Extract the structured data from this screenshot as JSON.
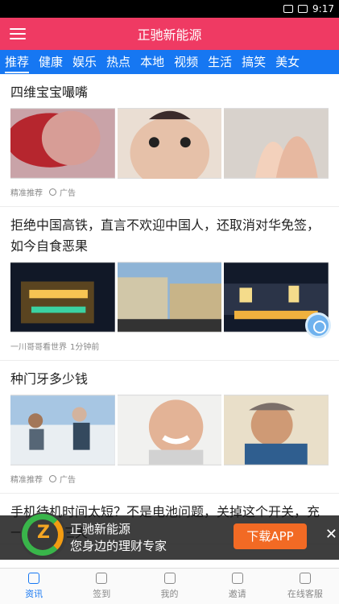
{
  "status": {
    "time": "9:17"
  },
  "appbar": {
    "title": "正驰新能源"
  },
  "tabs": [
    "推荐",
    "健康",
    "娱乐",
    "热点",
    "本地",
    "视频",
    "生活",
    "搞笑",
    "美女"
  ],
  "feed": [
    {
      "title": "四维宝宝嘬嘴",
      "meta1": "精准推荐",
      "meta2": "广告"
    },
    {
      "title": "拒绝中国高铁，直言不欢迎中国人，还取消对华免签，如今自食恶果",
      "meta1": "一川哥哥看世界",
      "meta2": "1分钟前"
    },
    {
      "title": "种门牙多少钱",
      "meta1": "精准推荐",
      "meta2": "广告"
    },
    {
      "title": "手机待机时间太短？不是电池问题，关掉这个开关，充一次能用三天"
    }
  ],
  "banner": {
    "logo_letter": "Z",
    "line1": "正驰新能源",
    "line2": "您身边的理财专家",
    "button": "下载APP",
    "close": "✕"
  },
  "bottom_nav": [
    "资讯",
    "签到",
    "我的",
    "邀请",
    "在线客服"
  ],
  "colors": {
    "appbar": "#ef3a63",
    "tabs": "#1677f2",
    "download": "#f26a24"
  }
}
